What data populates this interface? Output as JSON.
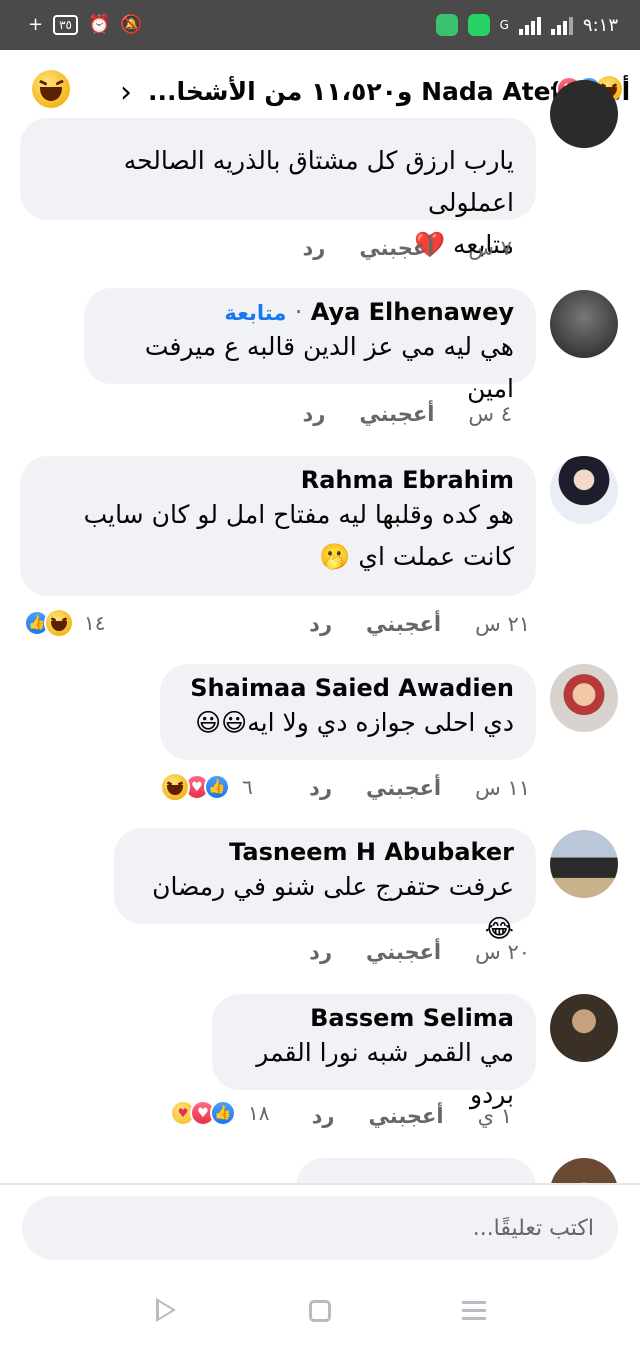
{
  "status_bar": {
    "left_badge": "٣٥",
    "time": "٩:١٣",
    "network": "G"
  },
  "header": {
    "title": "أنت وNada Atef و١١،٥٢٠ من الأشخا...",
    "reaction_icons": [
      "haha",
      "like",
      "love"
    ],
    "back_icon": "chevron-right-icon"
  },
  "comments": [
    {
      "text_lines": [
        "يارب ارزق كل مشتاق بالذريه الصالحه اعملولى",
        "متابعه ❤️"
      ],
      "time": "٧ س",
      "like_label": "أعجبني",
      "reply_label": "رد"
    },
    {
      "name": "Aya Elhenawey",
      "follow_label": "متابعة",
      "separator": "·",
      "text_lines": [
        "هي ليه مي عز الدين قالبه ع ميرفت امين"
      ],
      "time": "٤ س",
      "like_label": "أعجبني",
      "reply_label": "رد"
    },
    {
      "name": "Rahma Ebrahim",
      "text_lines": [
        "هو كده وقلبها ليه مفتاح امل لو كان سايب",
        "كانت عملت اي 🫢"
      ],
      "time": "٢١ س",
      "like_label": "أعجبني",
      "reply_label": "رد",
      "reaction_count": "١٤",
      "reactions": [
        "haha",
        "like"
      ]
    },
    {
      "name": "Shaimaa Saied Awadien",
      "text_lines": [
        "دي احلى جوازه دي ولا ايه😃😃"
      ],
      "time": "١١ س",
      "like_label": "أعجبني",
      "reply_label": "رد",
      "reaction_count": "٦",
      "reactions": [
        "like",
        "love",
        "haha"
      ]
    },
    {
      "name": "Tasneem H Abubaker",
      "text_lines": [
        "عرفت حتفرج على شنو في رمضان😂"
      ],
      "time": "٢٠ س",
      "like_label": "أعجبني",
      "reply_label": "رد"
    },
    {
      "name": "Bassem Selima",
      "text_lines": [
        "مي القمر شبه نورا القمر بردو"
      ],
      "time": "١ ي",
      "like_label": "أعجبني",
      "reply_label": "رد",
      "reaction_count": "١٨",
      "reactions": [
        "like",
        "love",
        "care"
      ]
    }
  ],
  "composer": {
    "placeholder": "اكتب تعليقًا..."
  },
  "colors": {
    "accent": "#1877f2",
    "bubble": "#f0f2f5",
    "meta": "#65676b",
    "status_bar": "#4a4a4a"
  }
}
